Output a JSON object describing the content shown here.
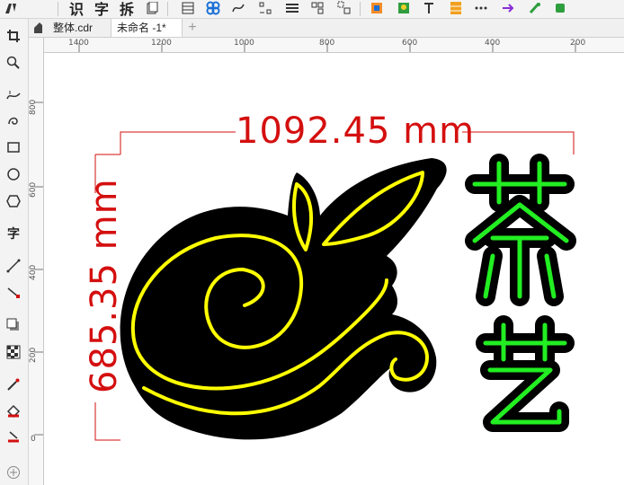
{
  "toolbar": {
    "items": [
      "识",
      "字",
      "拆"
    ],
    "icons": [
      "text-tool-icon",
      "table-icon",
      "knot-icon",
      "fx-icon",
      "align-icon",
      "lines-icon",
      "group-icon",
      "ungroup-icon",
      "image-a-icon",
      "image-b-icon",
      "text-tools-icon",
      "grid-icon",
      "dots-icon",
      "arrow-icon",
      "plugin-icon",
      "plugin-b-icon"
    ]
  },
  "tabs": [
    {
      "label": "整体.cdr",
      "active": false
    },
    {
      "label": "未命名 -1*",
      "active": true
    }
  ],
  "ruler": {
    "horizontal_labels": [
      "1400",
      "1200",
      "1000",
      "800",
      "600",
      "400",
      "200"
    ],
    "vertical_labels": [
      "800",
      "600",
      "400",
      "200",
      "0"
    ]
  },
  "drawing": {
    "width_dim": "1092.45 mm",
    "height_dim": "685.35 mm",
    "glyph_text": "茶艺",
    "colors": {
      "dimension": "#d40f0f",
      "fill": "#000000",
      "neon_yellow": "#ffff00",
      "neon_green": "#22ee22"
    }
  }
}
